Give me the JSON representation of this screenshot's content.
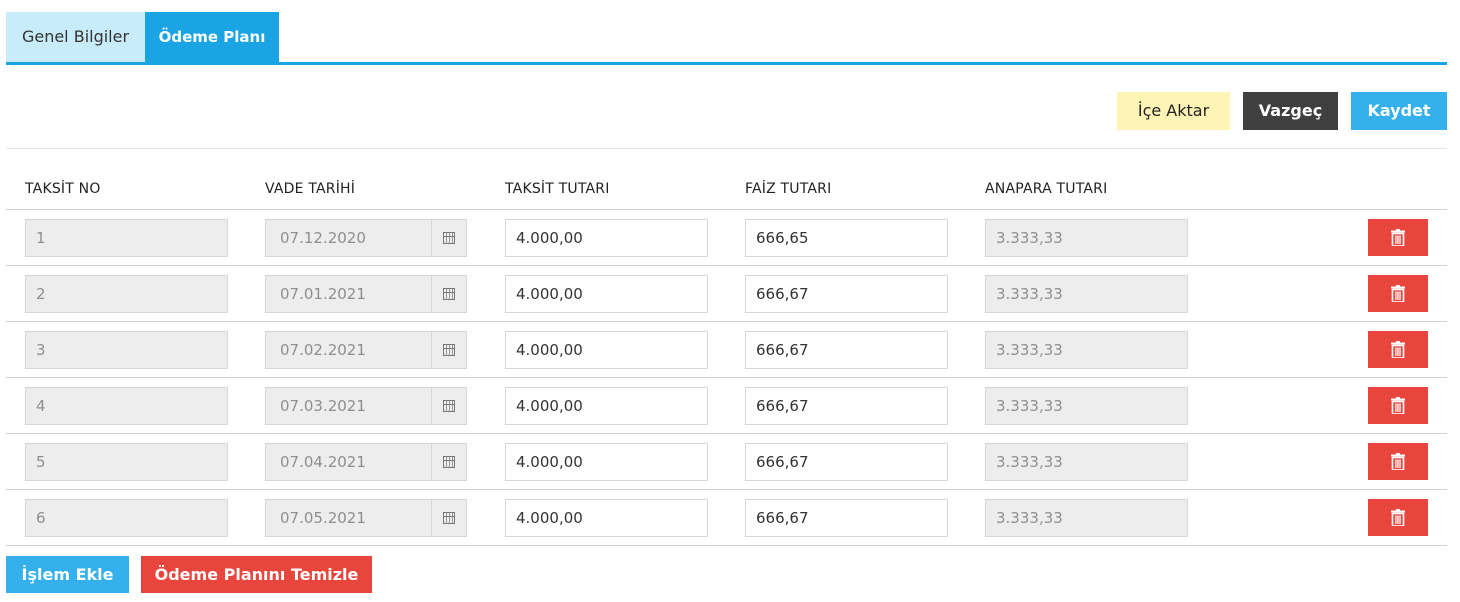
{
  "tabs": [
    {
      "label": "Genel Bilgiler",
      "active": false
    },
    {
      "label": "Ödeme Planı",
      "active": true
    }
  ],
  "toolbar": {
    "import_label": "İçe Aktar",
    "cancel_label": "Vazgeç",
    "save_label": "Kaydet"
  },
  "table": {
    "headers": [
      "TAKSİT NO",
      "VADE TARİHİ",
      "TAKSİT TUTARI",
      "FAİZ TUTARI",
      "ANAPARA TUTARI"
    ],
    "rows": [
      {
        "no": "1",
        "vade": "07.12.2020",
        "taksit": "4.000,00",
        "faiz": "666,65",
        "anapara": "3.333,33"
      },
      {
        "no": "2",
        "vade": "07.01.2021",
        "taksit": "4.000,00",
        "faiz": "666,67",
        "anapara": "3.333,33"
      },
      {
        "no": "3",
        "vade": "07.02.2021",
        "taksit": "4.000,00",
        "faiz": "666,67",
        "anapara": "3.333,33"
      },
      {
        "no": "4",
        "vade": "07.03.2021",
        "taksit": "4.000,00",
        "faiz": "666,67",
        "anapara": "3.333,33"
      },
      {
        "no": "5",
        "vade": "07.04.2021",
        "taksit": "4.000,00",
        "faiz": "666,67",
        "anapara": "3.333,33"
      },
      {
        "no": "6",
        "vade": "07.05.2021",
        "taksit": "4.000,00",
        "faiz": "666,67",
        "anapara": "3.333,33"
      }
    ]
  },
  "actions": {
    "add_label": "İşlem Ekle",
    "clear_label": "Ödeme Planını Temizle"
  },
  "icons": {
    "date": "calendar-icon",
    "delete": "trash-icon"
  },
  "colors": {
    "accent": "#1aa4e3",
    "tab_inactive": "#c9ecfb",
    "import": "#fff4b5",
    "cancel": "#3f3f3f",
    "save": "#36b0ec",
    "danger": "#e8453c"
  }
}
